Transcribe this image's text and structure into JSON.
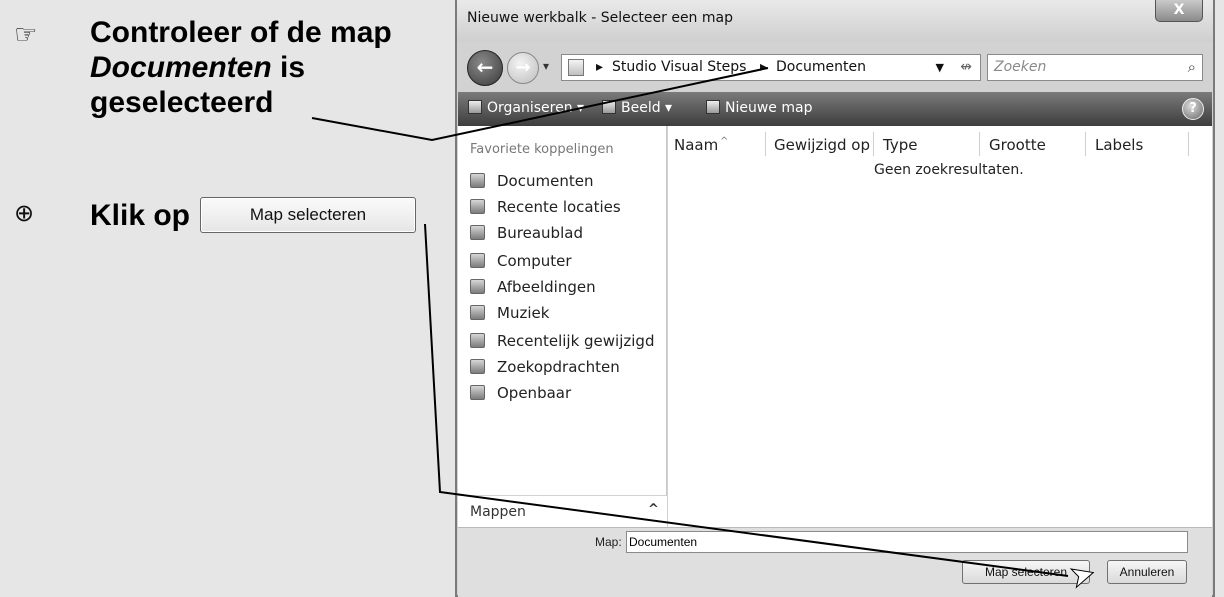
{
  "instructions": {
    "step1": {
      "icon": "pointing-hand-icon",
      "line1": "Controleer of de map",
      "line2_italic": "Documenten",
      "line2_rest": " is",
      "line3": "geselecteerd"
    },
    "step2": {
      "icon": "mouse-icon",
      "text": "Klik op",
      "button_label": "Map selecteren"
    }
  },
  "dialog": {
    "title": "Nieuwe werkbalk - Selecteer een map",
    "close_label": "X",
    "address": {
      "part1": "Studio Visual Steps",
      "separator": "▸",
      "part2": "Documenten"
    },
    "search_placeholder": "Zoeken",
    "toolbar": {
      "organize": "Organiseren",
      "view": "Beeld",
      "new_folder": "Nieuwe map",
      "help": "?"
    },
    "favorites": {
      "header": "Favoriete koppelingen",
      "items": [
        "Documenten",
        "Recente locaties",
        "Bureaublad",
        "Computer",
        "Afbeeldingen",
        "Muziek",
        "Recentelijk gewijzigd",
        "Zoekopdrachten",
        "Openbaar"
      ]
    },
    "folders_label": "Mappen",
    "columns": [
      "Naam",
      "Gewijzigd op",
      "Type",
      "Grootte",
      "Labels"
    ],
    "empty_message": "Geen zoekresultaten.",
    "folder_field_label": "Map:",
    "folder_field_value": "Documenten",
    "select_button": "Map selecteren",
    "cancel_button": "Annuleren"
  }
}
